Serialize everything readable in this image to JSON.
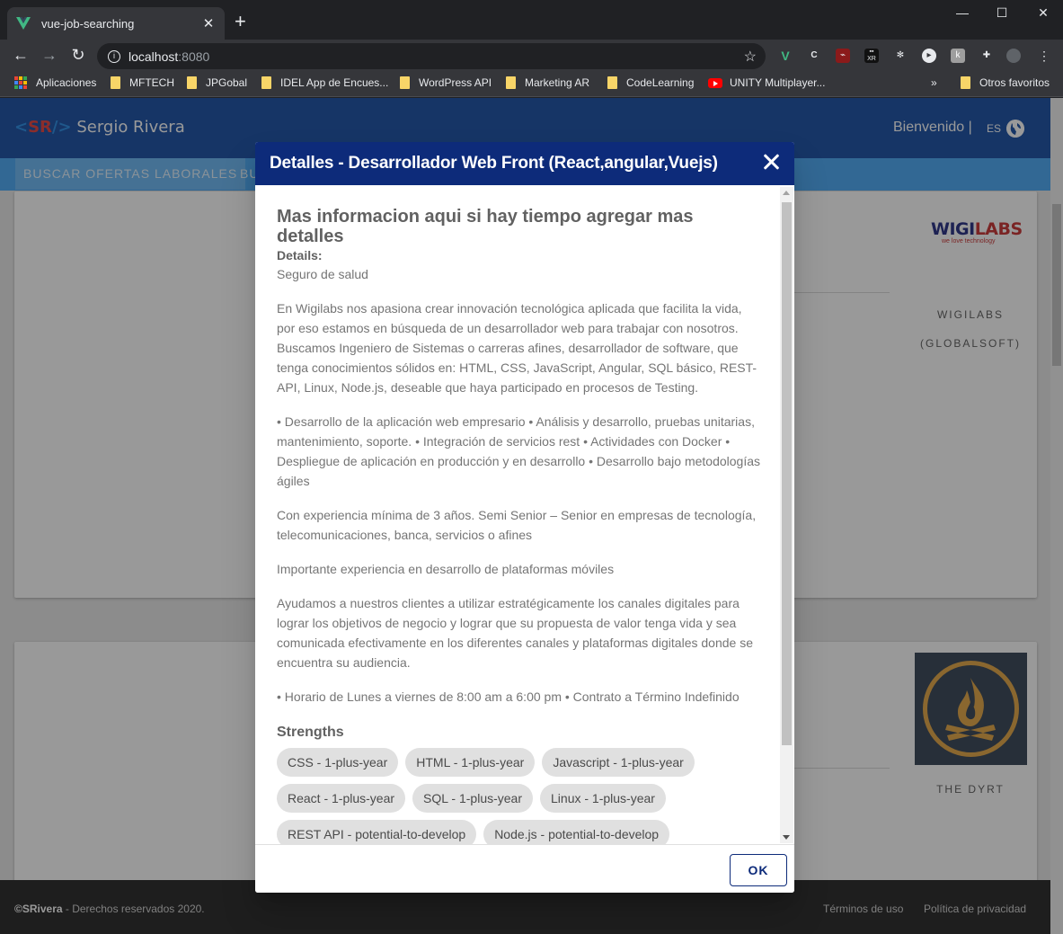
{
  "browser": {
    "tab_title": "vue-job-searching",
    "url_host": "localhost",
    "url_port": ":8080",
    "bookmarks": [
      {
        "label": "Aplicaciones",
        "type": "apps"
      },
      {
        "label": "MFTECH",
        "type": "folder"
      },
      {
        "label": "JPGobal",
        "type": "folder"
      },
      {
        "label": "IDEL App de Encues...",
        "type": "folder"
      },
      {
        "label": "WordPress API",
        "type": "folder"
      },
      {
        "label": "Marketing AR",
        "type": "folder"
      },
      {
        "label": "CodeLearning",
        "type": "folder"
      },
      {
        "label": "UNITY Multiplayer...",
        "type": "youtube"
      }
    ],
    "more_bookmarks": "»",
    "other_bookmarks": "Otros favoritos"
  },
  "app": {
    "brand_open": "<",
    "brand_sr": "SR",
    "brand_close": "/>",
    "brand_name": "Sergio Rivera",
    "welcome": "Bienvenido |",
    "lang": "ES",
    "nav_active": "BUSCAR OFERTAS LABORALES",
    "nav_next": "BU",
    "company1_line1": "WIGILABS",
    "company1_line2": "(GLOBALSOFT)",
    "company1_logo": "WIGI",
    "company1_logo_accent": "LABS",
    "company1_logo_tagline": "we love technology",
    "company2": "THE DYRT",
    "footer_brand": "©SRivera",
    "footer_rights": " - Derechos reservados 2020.",
    "footer_terms": "Términos de uso",
    "footer_privacy": "Política de privacidad"
  },
  "dialog": {
    "title": "Detalles - Desarrollador Web Front (React,angular,Vuejs)",
    "headline": "Mas informacion aqui si hay tiempo agregar mas detalles",
    "details_label": "Details:",
    "paragraphs": [
      "Seguro de salud",
      "En Wigilabs nos apasiona crear innovación tecnológica aplicada que facilita la vida, por eso estamos en búsqueda de un desarrollador web para trabajar con nosotros. Buscamos Ingeniero de Sistemas o carreras afines, desarrollador de software, que tenga conocimientos sólidos en: HTML, CSS, JavaScript, Angular, SQL básico, REST-API, Linux, Node.js, deseable que haya participado en procesos de Testing.",
      "• Desarrollo de la aplicación web empresario • Análisis y desarrollo, pruebas unitarias, mantenimiento, soporte. • Integración de servicios rest • Actividades con Docker • Despliegue de aplicación en producción y en desarrollo • Desarrollo bajo metodologías ágiles",
      "Con experiencia mínima de 3 años. Semi Senior – Senior en empresas de tecnología, telecomunicaciones, banca, servicios o afines",
      "Importante experiencia en desarrollo de plataformas móviles",
      "Ayudamos a nuestros clientes a utilizar estratégicamente los canales digitales para lograr los objetivos de negocio y lograr que su propuesta de valor tenga vida y sea comunicada efectivamente en los diferentes canales y plataformas digitales donde se encuentra su audiencia.",
      "• Horario de Lunes a viernes de 8:00 am a 6:00 pm • Contrato a Término Indefinido"
    ],
    "strengths_label": "Strengths",
    "strengths": [
      "CSS - 1-plus-year",
      "HTML - 1-plus-year",
      "Javascript - 1-plus-year",
      "React - 1-plus-year",
      "SQL - 1-plus-year",
      "Linux - 1-plus-year",
      "REST API - potential-to-develop",
      "Node.js - potential-to-develop"
    ],
    "ok_label": "OK"
  }
}
